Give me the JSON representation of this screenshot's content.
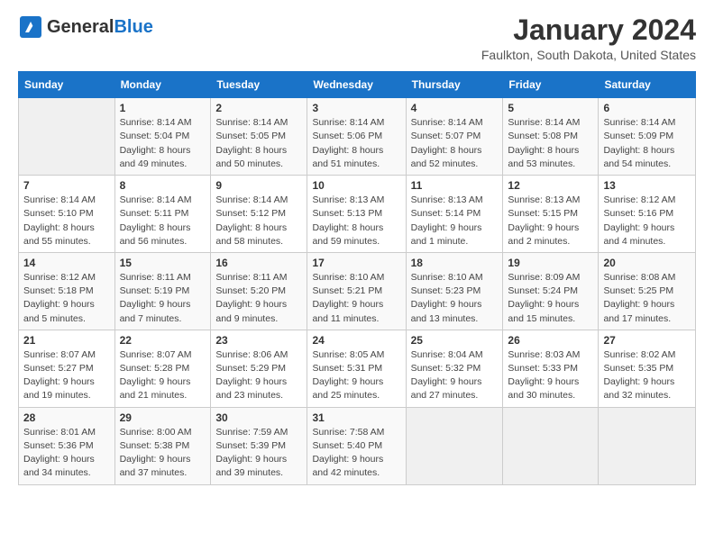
{
  "header": {
    "logo_general": "General",
    "logo_blue": "Blue",
    "title": "January 2024",
    "subtitle": "Faulkton, South Dakota, United States"
  },
  "weekdays": [
    "Sunday",
    "Monday",
    "Tuesday",
    "Wednesday",
    "Thursday",
    "Friday",
    "Saturday"
  ],
  "weeks": [
    [
      {
        "day": "",
        "sunrise": "",
        "sunset": "",
        "daylight": ""
      },
      {
        "day": "1",
        "sunrise": "8:14 AM",
        "sunset": "5:04 PM",
        "daylight": "8 hours and 49 minutes."
      },
      {
        "day": "2",
        "sunrise": "8:14 AM",
        "sunset": "5:05 PM",
        "daylight": "8 hours and 50 minutes."
      },
      {
        "day": "3",
        "sunrise": "8:14 AM",
        "sunset": "5:06 PM",
        "daylight": "8 hours and 51 minutes."
      },
      {
        "day": "4",
        "sunrise": "8:14 AM",
        "sunset": "5:07 PM",
        "daylight": "8 hours and 52 minutes."
      },
      {
        "day": "5",
        "sunrise": "8:14 AM",
        "sunset": "5:08 PM",
        "daylight": "8 hours and 53 minutes."
      },
      {
        "day": "6",
        "sunrise": "8:14 AM",
        "sunset": "5:09 PM",
        "daylight": "8 hours and 54 minutes."
      }
    ],
    [
      {
        "day": "7",
        "sunrise": "8:14 AM",
        "sunset": "5:10 PM",
        "daylight": "8 hours and 55 minutes."
      },
      {
        "day": "8",
        "sunrise": "8:14 AM",
        "sunset": "5:11 PM",
        "daylight": "8 hours and 56 minutes."
      },
      {
        "day": "9",
        "sunrise": "8:14 AM",
        "sunset": "5:12 PM",
        "daylight": "8 hours and 58 minutes."
      },
      {
        "day": "10",
        "sunrise": "8:13 AM",
        "sunset": "5:13 PM",
        "daylight": "8 hours and 59 minutes."
      },
      {
        "day": "11",
        "sunrise": "8:13 AM",
        "sunset": "5:14 PM",
        "daylight": "9 hours and 1 minute."
      },
      {
        "day": "12",
        "sunrise": "8:13 AM",
        "sunset": "5:15 PM",
        "daylight": "9 hours and 2 minutes."
      },
      {
        "day": "13",
        "sunrise": "8:12 AM",
        "sunset": "5:16 PM",
        "daylight": "9 hours and 4 minutes."
      }
    ],
    [
      {
        "day": "14",
        "sunrise": "8:12 AM",
        "sunset": "5:18 PM",
        "daylight": "9 hours and 5 minutes."
      },
      {
        "day": "15",
        "sunrise": "8:11 AM",
        "sunset": "5:19 PM",
        "daylight": "9 hours and 7 minutes."
      },
      {
        "day": "16",
        "sunrise": "8:11 AM",
        "sunset": "5:20 PM",
        "daylight": "9 hours and 9 minutes."
      },
      {
        "day": "17",
        "sunrise": "8:10 AM",
        "sunset": "5:21 PM",
        "daylight": "9 hours and 11 minutes."
      },
      {
        "day": "18",
        "sunrise": "8:10 AM",
        "sunset": "5:23 PM",
        "daylight": "9 hours and 13 minutes."
      },
      {
        "day": "19",
        "sunrise": "8:09 AM",
        "sunset": "5:24 PM",
        "daylight": "9 hours and 15 minutes."
      },
      {
        "day": "20",
        "sunrise": "8:08 AM",
        "sunset": "5:25 PM",
        "daylight": "9 hours and 17 minutes."
      }
    ],
    [
      {
        "day": "21",
        "sunrise": "8:07 AM",
        "sunset": "5:27 PM",
        "daylight": "9 hours and 19 minutes."
      },
      {
        "day": "22",
        "sunrise": "8:07 AM",
        "sunset": "5:28 PM",
        "daylight": "9 hours and 21 minutes."
      },
      {
        "day": "23",
        "sunrise": "8:06 AM",
        "sunset": "5:29 PM",
        "daylight": "9 hours and 23 minutes."
      },
      {
        "day": "24",
        "sunrise": "8:05 AM",
        "sunset": "5:31 PM",
        "daylight": "9 hours and 25 minutes."
      },
      {
        "day": "25",
        "sunrise": "8:04 AM",
        "sunset": "5:32 PM",
        "daylight": "9 hours and 27 minutes."
      },
      {
        "day": "26",
        "sunrise": "8:03 AM",
        "sunset": "5:33 PM",
        "daylight": "9 hours and 30 minutes."
      },
      {
        "day": "27",
        "sunrise": "8:02 AM",
        "sunset": "5:35 PM",
        "daylight": "9 hours and 32 minutes."
      }
    ],
    [
      {
        "day": "28",
        "sunrise": "8:01 AM",
        "sunset": "5:36 PM",
        "daylight": "9 hours and 34 minutes."
      },
      {
        "day": "29",
        "sunrise": "8:00 AM",
        "sunset": "5:38 PM",
        "daylight": "9 hours and 37 minutes."
      },
      {
        "day": "30",
        "sunrise": "7:59 AM",
        "sunset": "5:39 PM",
        "daylight": "9 hours and 39 minutes."
      },
      {
        "day": "31",
        "sunrise": "7:58 AM",
        "sunset": "5:40 PM",
        "daylight": "9 hours and 42 minutes."
      },
      {
        "day": "",
        "sunrise": "",
        "sunset": "",
        "daylight": ""
      },
      {
        "day": "",
        "sunrise": "",
        "sunset": "",
        "daylight": ""
      },
      {
        "day": "",
        "sunrise": "",
        "sunset": "",
        "daylight": ""
      }
    ]
  ],
  "labels": {
    "sunrise": "Sunrise:",
    "sunset": "Sunset:",
    "daylight": "Daylight:"
  }
}
